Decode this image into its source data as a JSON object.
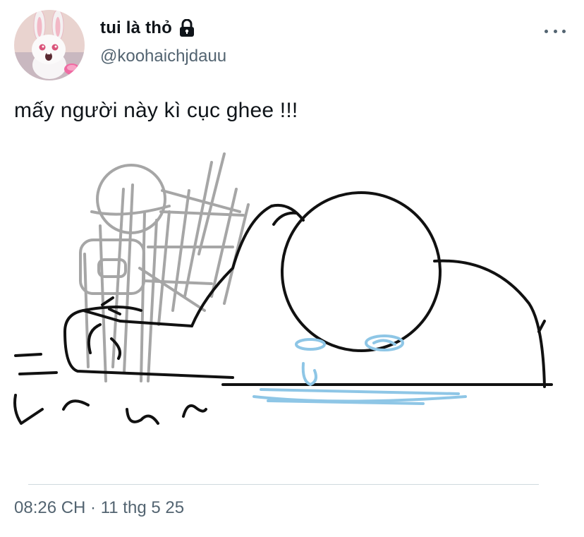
{
  "user": {
    "display_name": "tui là thỏ",
    "handle": "@koohaichjdauu",
    "protected": true
  },
  "tweet": {
    "text": "mấy người này kì cục ghee !!!",
    "timestamp": "08:26 CH · 11 thg 5 25"
  },
  "icons": {
    "lock": "lock-icon",
    "more": "more-dots-icon",
    "avatar": "bunny-avatar"
  },
  "colors": {
    "text_primary": "#0f1419",
    "text_secondary": "#536471",
    "divider": "#cfd9de",
    "sketch_black": "#111111",
    "sketch_gray": "#9a9a9a",
    "sketch_blue": "#8ec6e6"
  }
}
